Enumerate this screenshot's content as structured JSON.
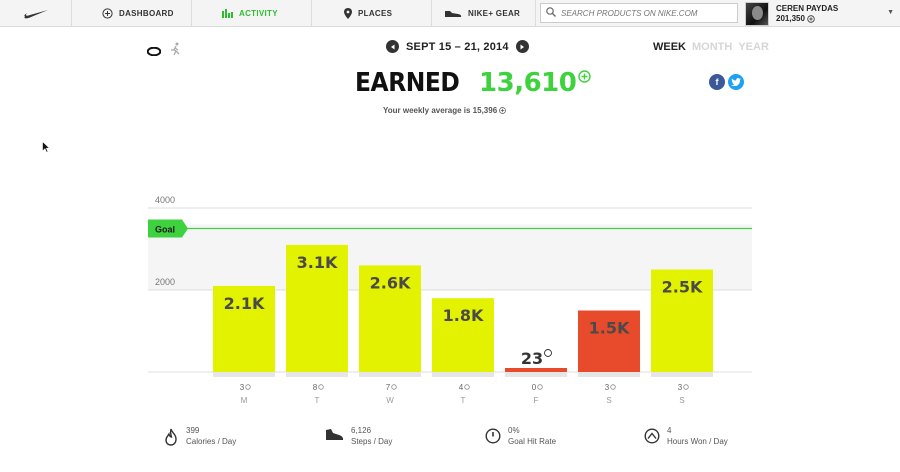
{
  "nav": {
    "logo": "nike-swoosh-icon",
    "items": [
      {
        "label": "DASHBOARD",
        "icon": "plus-circle-icon"
      },
      {
        "label": "ACTIVITY",
        "icon": "bar-chart-icon",
        "active": true
      },
      {
        "label": "PLACES",
        "icon": "map-pin-icon"
      },
      {
        "label": "NIKE+ GEAR",
        "icon": "shoe-icon"
      }
    ],
    "search_placeholder": "SEARCH PRODUCTS ON NIKE.COM",
    "user": {
      "name": "CEREN PAYDAS",
      "points": "201,350"
    }
  },
  "subheader": {
    "date_range": "SEPT 15 – 21, 2014",
    "periods": [
      {
        "label": "WEEK",
        "active": true
      },
      {
        "label": "MONTH",
        "active": false
      },
      {
        "label": "YEAR",
        "active": false
      }
    ],
    "earned_label": "EARNED",
    "earned_value": "13,610",
    "weekly_average": "Your weekly average is 15,396"
  },
  "colors": {
    "accent_green": "#3fd23f",
    "bar_yellow": "#e2f200",
    "bar_red": "#e84a2c",
    "facebook": "#3b5998",
    "twitter": "#1da1f2"
  },
  "chart_data": {
    "type": "bar",
    "categories": [
      "M",
      "T",
      "W",
      "T",
      "F",
      "S",
      "S"
    ],
    "values": [
      2100,
      3100,
      2600,
      1800,
      23,
      1500,
      2500
    ],
    "value_labels": [
      "2.1K",
      "3.1K",
      "2.6K",
      "1.8K",
      "23",
      "1.5K",
      "2.5K"
    ],
    "counts": [
      "3",
      "8",
      "7",
      "4",
      "0",
      "3",
      "3"
    ],
    "below_goal": [
      false,
      false,
      false,
      false,
      true,
      true,
      false
    ],
    "goal_label": "Goal",
    "goal_value": 3500,
    "yticks": [
      4000,
      2000
    ],
    "ylim": [
      0,
      4000
    ]
  },
  "stats": [
    {
      "value": "399",
      "label": "Calories / Day",
      "icon": "flame-icon"
    },
    {
      "value": "6,126",
      "label": "Steps / Day",
      "icon": "shoe-icon"
    },
    {
      "value": "0%",
      "label": "Goal Hit Rate",
      "icon": "clock-icon"
    },
    {
      "value": "4",
      "label": "Hours Won / Day",
      "icon": "mountain-icon"
    }
  ]
}
